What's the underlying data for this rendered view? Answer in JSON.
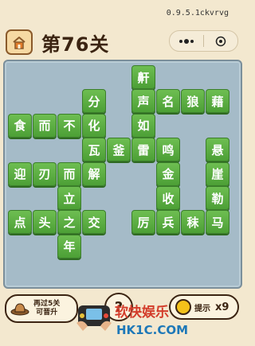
{
  "header": {
    "version": "0.9.5.1ckvrvg",
    "level_title": "第76关"
  },
  "board": {
    "tiles": [
      {
        "char": "鼾",
        "row": 0,
        "col": 5
      },
      {
        "char": "分",
        "row": 1,
        "col": 3
      },
      {
        "char": "声",
        "row": 1,
        "col": 5
      },
      {
        "char": "名",
        "row": 1,
        "col": 6
      },
      {
        "char": "狼",
        "row": 1,
        "col": 7
      },
      {
        "char": "藉",
        "row": 1,
        "col": 8
      },
      {
        "char": "食",
        "row": 2,
        "col": 0
      },
      {
        "char": "而",
        "row": 2,
        "col": 1
      },
      {
        "char": "不",
        "row": 2,
        "col": 2
      },
      {
        "char": "化",
        "row": 2,
        "col": 3
      },
      {
        "char": "如",
        "row": 2,
        "col": 5
      },
      {
        "char": "瓦",
        "row": 3,
        "col": 3
      },
      {
        "char": "釜",
        "row": 3,
        "col": 4
      },
      {
        "char": "雷",
        "row": 3,
        "col": 5
      },
      {
        "char": "鸣",
        "row": 3,
        "col": 6
      },
      {
        "char": "悬",
        "row": 3,
        "col": 8
      },
      {
        "char": "迎",
        "row": 4,
        "col": 0
      },
      {
        "char": "刃",
        "row": 4,
        "col": 1
      },
      {
        "char": "而",
        "row": 4,
        "col": 2
      },
      {
        "char": "解",
        "row": 4,
        "col": 3
      },
      {
        "char": "金",
        "row": 4,
        "col": 6
      },
      {
        "char": "崖",
        "row": 4,
        "col": 8
      },
      {
        "char": "立",
        "row": 5,
        "col": 2
      },
      {
        "char": "收",
        "row": 5,
        "col": 6
      },
      {
        "char": "勒",
        "row": 5,
        "col": 8
      },
      {
        "char": "点",
        "row": 6,
        "col": 0
      },
      {
        "char": "头",
        "row": 6,
        "col": 1
      },
      {
        "char": "之",
        "row": 6,
        "col": 2
      },
      {
        "char": "交",
        "row": 6,
        "col": 3
      },
      {
        "char": "厉",
        "row": 6,
        "col": 5
      },
      {
        "char": "兵",
        "row": 6,
        "col": 6
      },
      {
        "char": "秣",
        "row": 6,
        "col": 7
      },
      {
        "char": "马",
        "row": 6,
        "col": 8
      },
      {
        "char": "年",
        "row": 7,
        "col": 2
      }
    ]
  },
  "bottom": {
    "promo_line1": "再过5关",
    "promo_line2": "可晋升",
    "help_label": "?",
    "hint_label": "提示",
    "hint_count": "x9"
  },
  "watermark": {
    "brand": "软快娱乐",
    "url": "HK1C.COM"
  },
  "colors": {
    "tile_green": "#5aad40",
    "background": "#f3e8cf",
    "board": "#a5bbc8"
  }
}
